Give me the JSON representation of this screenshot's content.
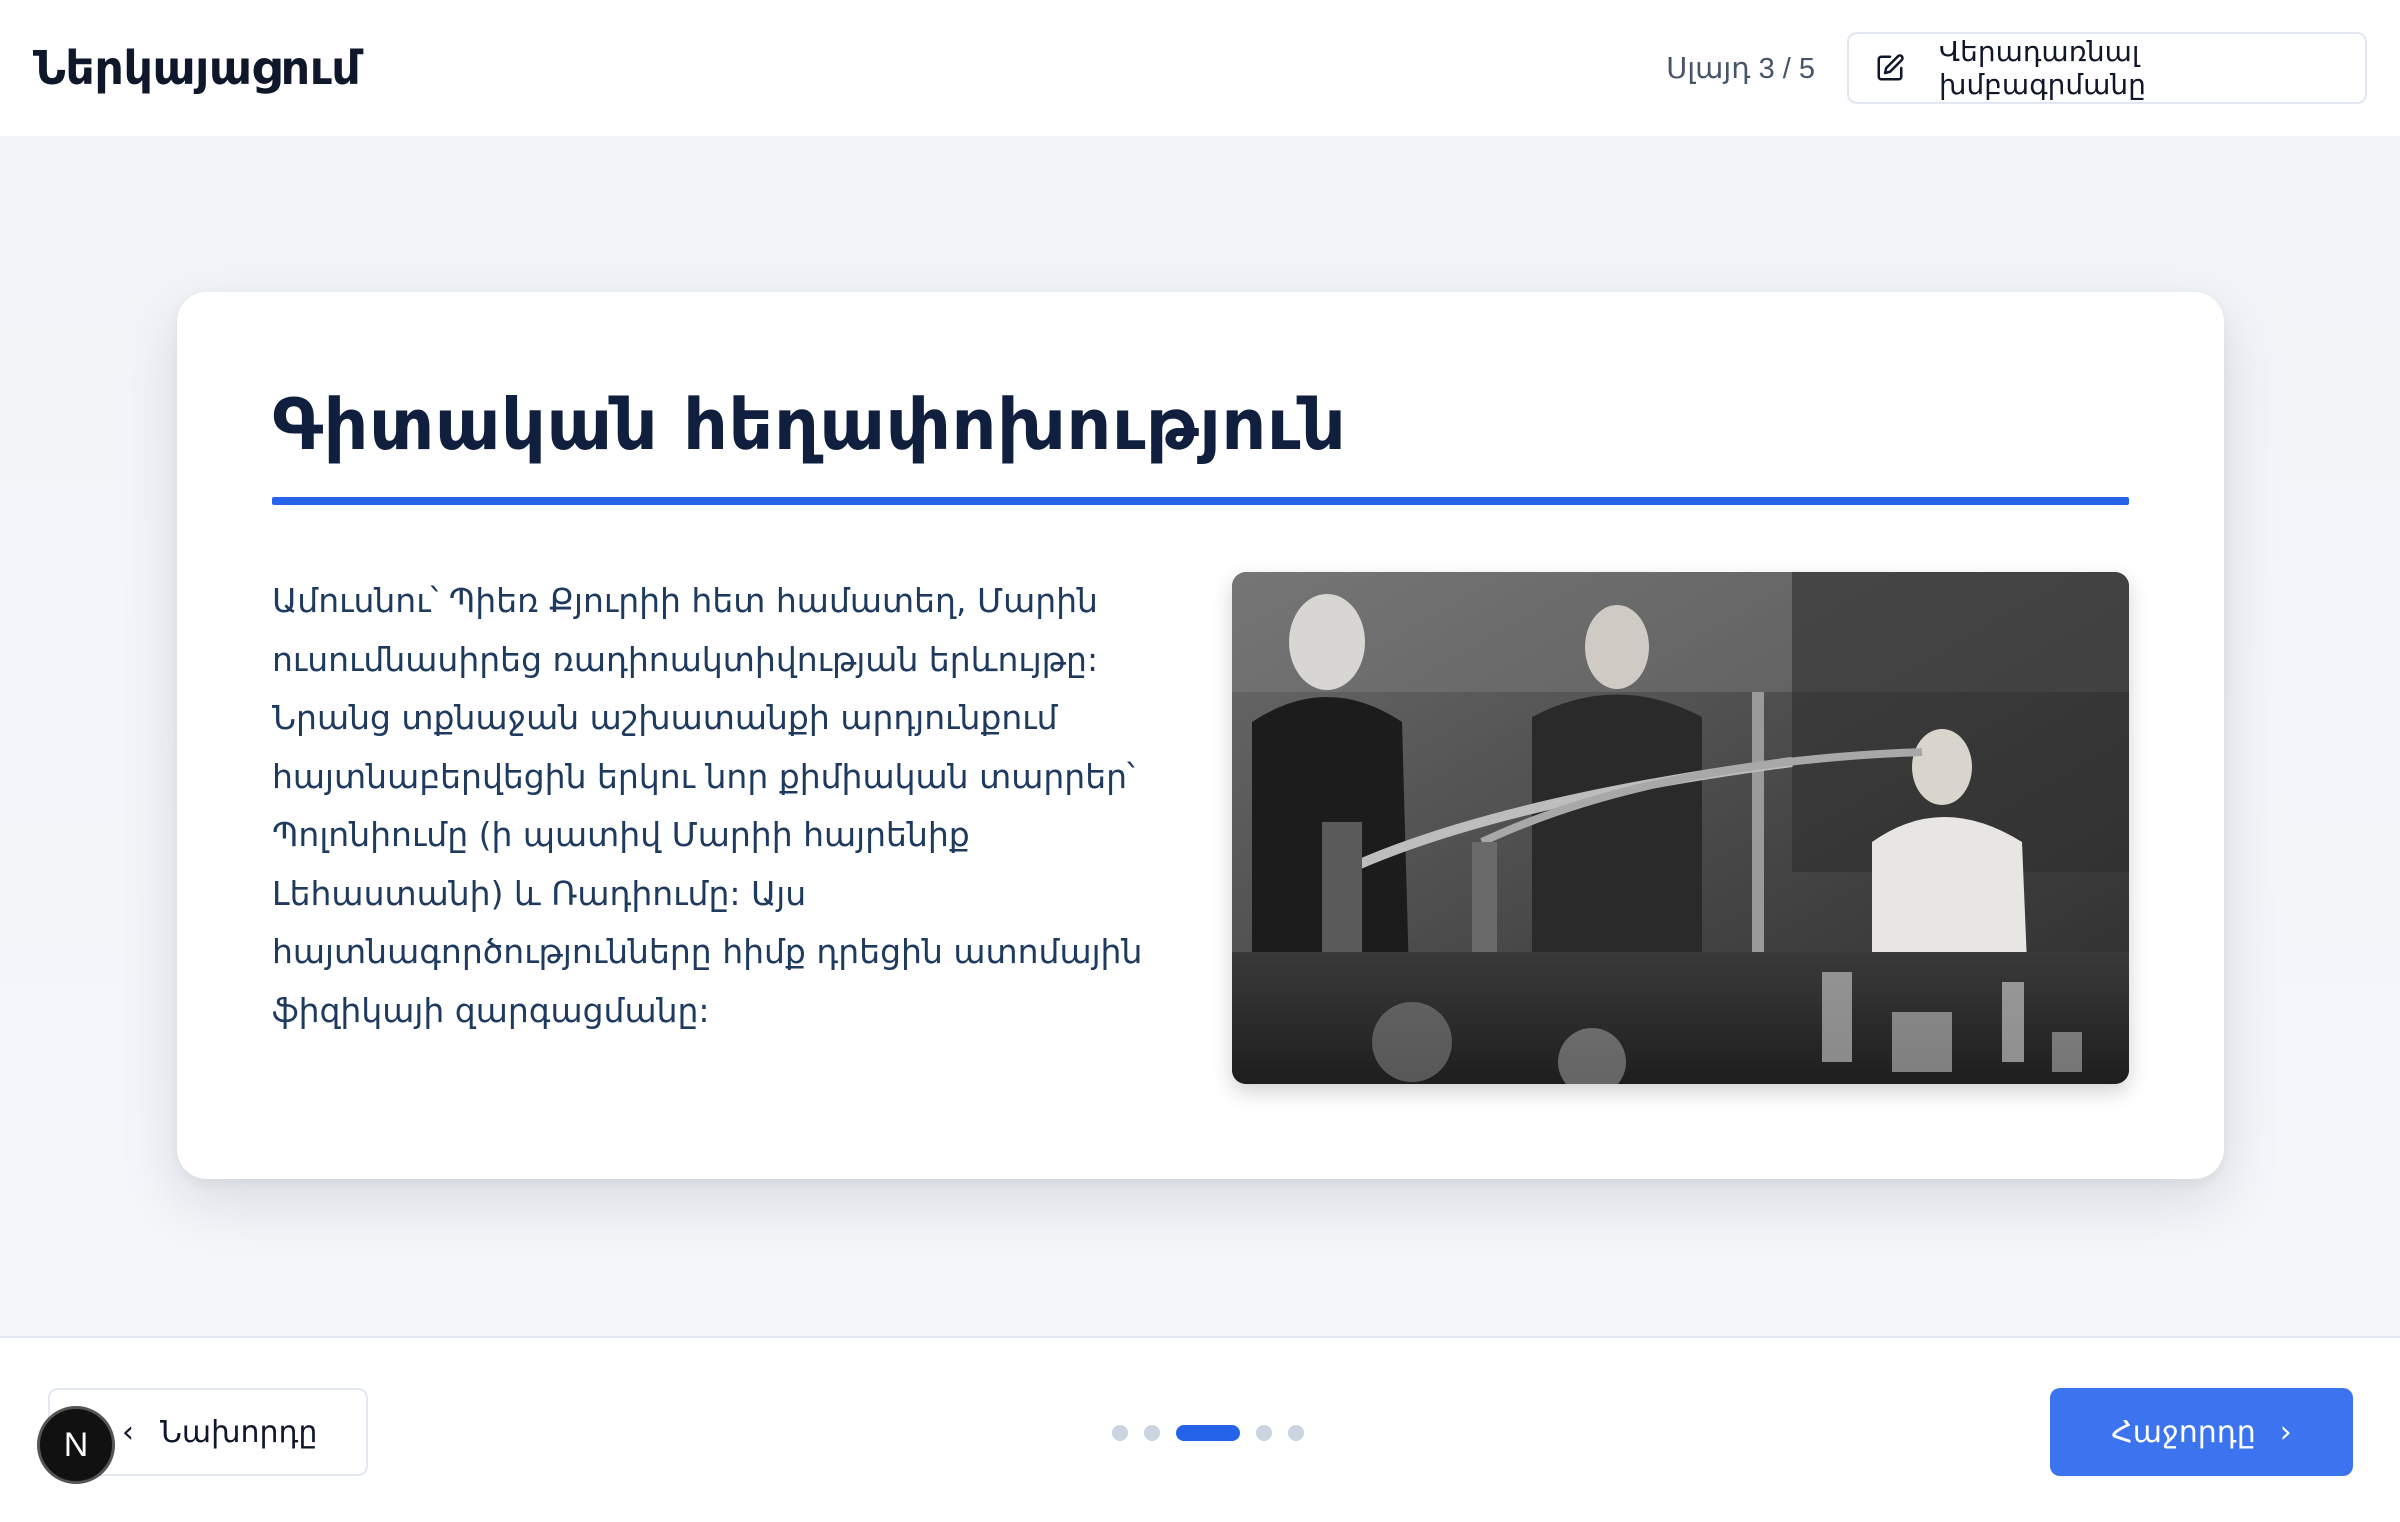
{
  "header": {
    "title": "Ներկայացում",
    "slide_counter": "Սլայդ 3 / 5",
    "edit_button_label": "Վերադառնալ խմբագրմանը",
    "edit_icon": "pencil-square-icon"
  },
  "slide": {
    "title": "Գիտական հեղափոխություն",
    "accent_color": "#2563eb",
    "body": "Ամուսնու՝ Պիեռ Քյուրիի հետ համատեղ, Մարին ուսումնասիրեց ռադիոակտիվության երևույթը: Նրանց տքնաջան աշխատանքի արդյունքում հայտնաբերվեցին երկու նոր քիմիական տարրեր՝ Պոլոնիումը (ի պատիվ Մարիի հայրենիք Լեհաստանի) և Ռադիումը: Այս հայտնագործությունները հիմք դրեցին ատոմային ֆիզիկայի զարգացմանը:"
  },
  "navigation": {
    "prev_label": "Նախորդը",
    "next_label": "Հաջորդը",
    "prev_icon": "chevron-left-icon",
    "next_icon": "chevron-right-icon",
    "total_slides": 5,
    "current_slide": 3,
    "next_color": "#3b74ee"
  },
  "badge": {
    "letter": "N"
  }
}
